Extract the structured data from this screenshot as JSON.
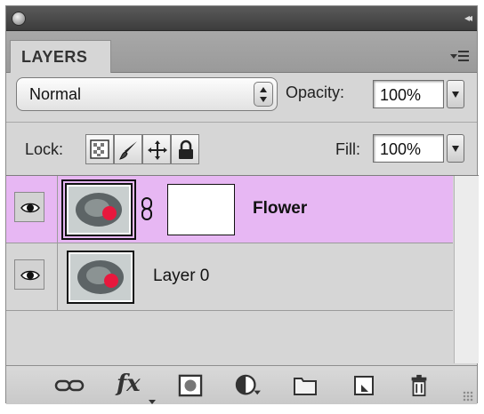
{
  "panel": {
    "tab_label": "LAYERS"
  },
  "blend_mode": {
    "value": "Normal"
  },
  "opacity": {
    "label": "Opacity:",
    "value": "100%"
  },
  "lock": {
    "label": "Lock:",
    "buttons": [
      "lock-transparent-pixels",
      "lock-image-pixels",
      "lock-position",
      "lock-all"
    ]
  },
  "fill": {
    "label": "Fill:",
    "value": "100%"
  },
  "layers": [
    {
      "name": "Flower",
      "visible": true,
      "selected": true,
      "has_mask": true,
      "linked": true
    },
    {
      "name": "Layer 0",
      "visible": true,
      "selected": false,
      "has_mask": false,
      "linked": false
    }
  ],
  "bottom_toolbar": {
    "buttons": [
      "link-layers",
      "layer-style-fx",
      "add-layer-mask",
      "new-adjustment-layer",
      "new-group",
      "new-layer",
      "delete-layer"
    ],
    "fx_label": "fx"
  },
  "colors": {
    "selected_row": "#e7b7f3",
    "panel_bg": "#d6d6d6",
    "flower_red": "#e8183d"
  }
}
